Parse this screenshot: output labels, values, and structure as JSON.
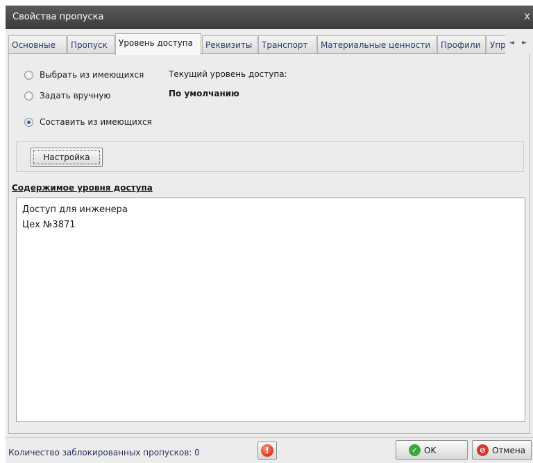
{
  "window": {
    "title": "Свойства пропуска",
    "close_glyph": "x"
  },
  "tabs": [
    {
      "label": "Основные"
    },
    {
      "label": "Пропуск"
    },
    {
      "label": "Уровень доступа"
    },
    {
      "label": "Реквизиты"
    },
    {
      "label": "Транспорт"
    },
    {
      "label": "Материальные ценности"
    },
    {
      "label": "Профили"
    },
    {
      "label": "Упр"
    }
  ],
  "active_tab": "Уровень доступа",
  "tab_scroll": {
    "left_glyph": "◄",
    "right_glyph": "►"
  },
  "access_mode": {
    "options": [
      {
        "label": "Выбрать из имеющихся",
        "checked": false
      },
      {
        "label": "Задать вручную",
        "checked": false
      },
      {
        "label": "Составить из имеющихся",
        "checked": true
      }
    ]
  },
  "current_level": {
    "label": "Текущий уровень доступа:",
    "value": "По умолчанию"
  },
  "settings_button": {
    "label": "Настройка"
  },
  "contents": {
    "title": "Содержимое уровня доступа",
    "lines": [
      "Доступ для инженера",
      "Цех №3871"
    ]
  },
  "footer": {
    "blocked_label": "Количество заблокированных пропусков: 0",
    "alert_glyph": "!",
    "ok_label": "OK",
    "ok_glyph": "✓",
    "cancel_label": "Отмена",
    "cancel_glyph": "⊘"
  },
  "colors": {
    "titlebar": "#4a4a4a",
    "ok_icon": "#3aa83a",
    "cancel_icon": "#d23b2a",
    "alert_icon": "#d9361a"
  }
}
